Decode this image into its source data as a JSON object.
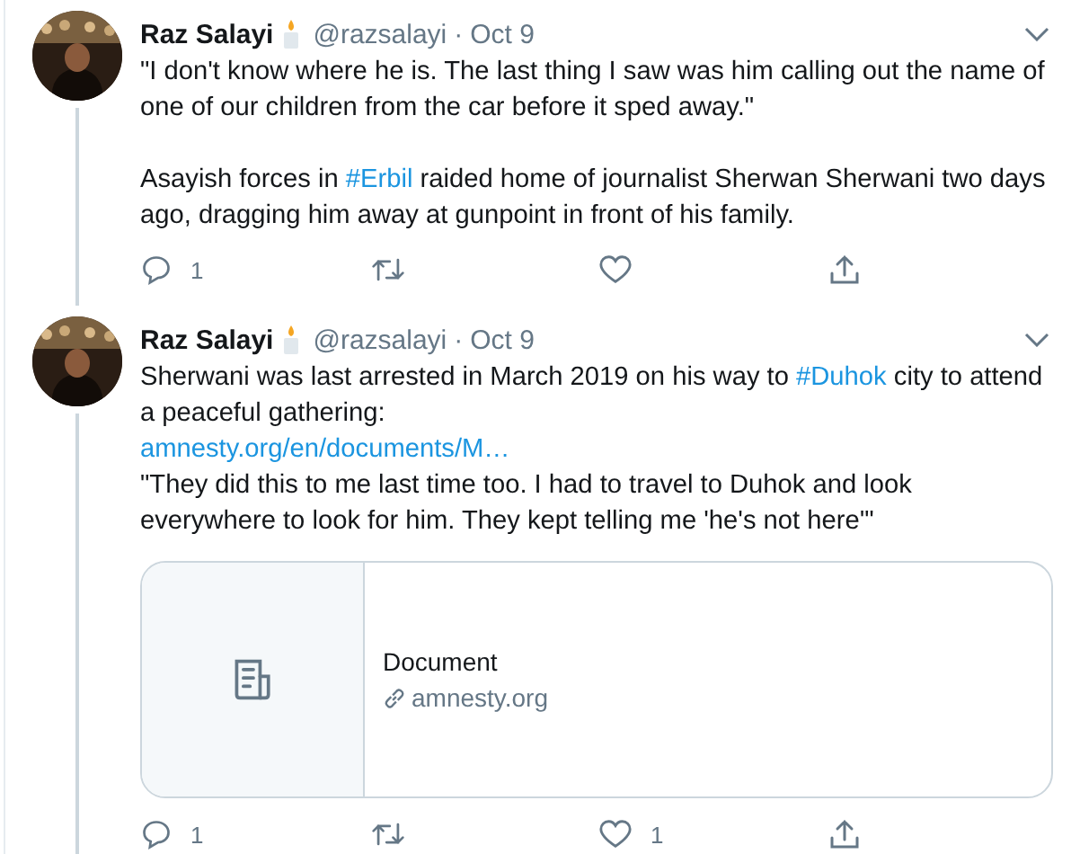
{
  "tweets": [
    {
      "name": "Raz Salayi",
      "handle": "@razsalayi",
      "separator": "·",
      "date": "Oct 9",
      "thread": true,
      "text": [
        {
          "kind": "text",
          "text": "\"I don't know where he is. The last thing I saw was him calling out the name of one of our children from the car before it sped away.\"\n\nAsayish forces in "
        },
        {
          "kind": "hashtag",
          "text": "#Erbil"
        },
        {
          "kind": "text",
          "text": " raided home of journalist Sherwan Sherwani two days ago, dragging him away at gunpoint in front of his family."
        }
      ],
      "actions": [
        {
          "kind": "reply",
          "count": "1"
        },
        {
          "kind": "retweet"
        },
        {
          "kind": "like"
        },
        {
          "kind": "share"
        }
      ]
    },
    {
      "name": "Raz Salayi",
      "handle": "@razsalayi",
      "separator": "·",
      "date": "Oct 9",
      "thread": true,
      "text": [
        {
          "kind": "text",
          "text": "Sherwani was last arrested in March 2019 on his way to "
        },
        {
          "kind": "hashtag",
          "text": "#Duhok"
        },
        {
          "kind": "text",
          "text": " city to attend a peaceful gathering:\n"
        },
        {
          "kind": "link",
          "text": "amnesty.org/en/documents/M…"
        },
        {
          "kind": "text",
          "text": "\n\"They did this to me last time too. I had to travel to Duhok and look everywhere to look for him. They kept telling me 'he's not here'\""
        }
      ],
      "card": {
        "title": "Document",
        "domain": "amnesty.org"
      },
      "actions": [
        {
          "kind": "reply",
          "count": "1"
        },
        {
          "kind": "retweet"
        },
        {
          "kind": "like",
          "count": "1"
        },
        {
          "kind": "share"
        }
      ]
    }
  ]
}
